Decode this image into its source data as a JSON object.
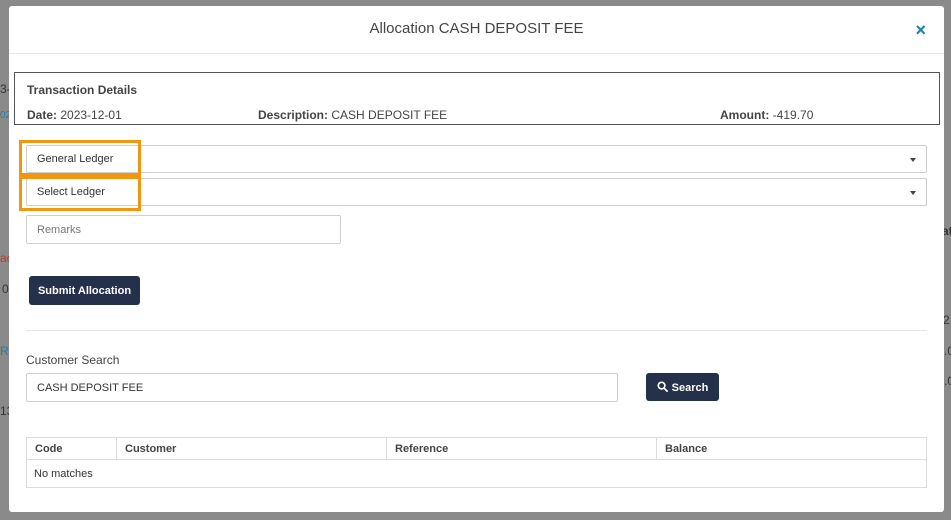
{
  "modal": {
    "title": "Allocation CASH DEPOSIT FEE",
    "close_glyph": "×"
  },
  "transaction": {
    "heading": "Transaction Details",
    "date_label": "Date:",
    "date": "2023-12-01",
    "description_label": "Description:",
    "description": "CASH DEPOSIT FEE",
    "amount_label": "Amount:",
    "amount": "-419.70"
  },
  "ledger_select": {
    "value": "General Ledger"
  },
  "sub_ledger_select": {
    "value": "Select Ledger"
  },
  "remarks": {
    "placeholder": "Remarks",
    "value": ""
  },
  "submit_label": "Submit Allocation",
  "customer_search": {
    "label": "Customer Search",
    "value": "CASH DEPOSIT FEE",
    "button_label": "Search"
  },
  "results": {
    "columns": [
      "Code",
      "Customer",
      "Reference",
      "Balance"
    ],
    "empty_message": "No matches"
  },
  "colors": {
    "accent_dark": "#25304a",
    "close_icon": "#1f7fa8",
    "highlight": "#f0960f"
  },
  "background_fragments": [
    "3-",
    "02",
    "ac",
    "0",
    "R",
    "13",
    "at",
    "2.",
    ".0",
    ".0"
  ]
}
